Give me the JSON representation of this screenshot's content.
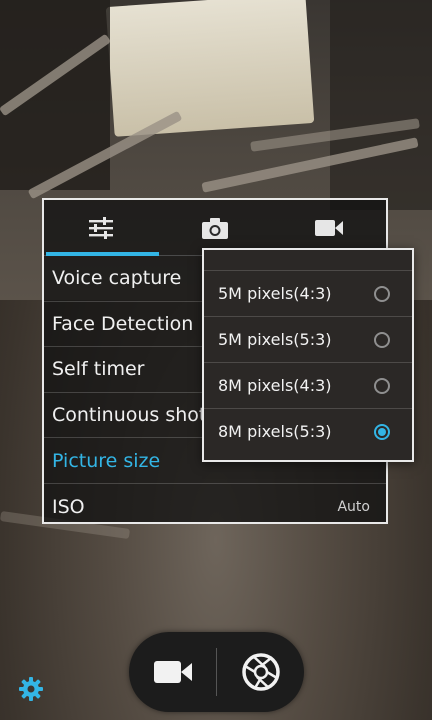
{
  "settings": {
    "tabs": [
      {
        "icon": "sliders-icon",
        "selected": true
      },
      {
        "icon": "camera-icon",
        "selected": false
      },
      {
        "icon": "video-icon",
        "selected": false
      }
    ],
    "rows": [
      {
        "label": "Voice capture",
        "value": ""
      },
      {
        "label": "Face Detection",
        "value": ""
      },
      {
        "label": "Self timer",
        "value": ""
      },
      {
        "label": "Continuous shot",
        "value": ""
      },
      {
        "label": "Picture size",
        "value": "",
        "active": true
      },
      {
        "label": "ISO",
        "value": "Auto"
      }
    ]
  },
  "picture_size_popup": {
    "options": [
      {
        "label": "5M pixels(4:3)",
        "checked": false
      },
      {
        "label": "5M pixels(5:3)",
        "checked": false
      },
      {
        "label": "8M pixels(4:3)",
        "checked": false
      },
      {
        "label": "8M pixels(5:3)",
        "checked": true
      }
    ]
  },
  "controls": {
    "left_icon": "video-camera-icon",
    "right_icon": "shutter-icon"
  },
  "colors": {
    "accent": "#33b5e5"
  }
}
